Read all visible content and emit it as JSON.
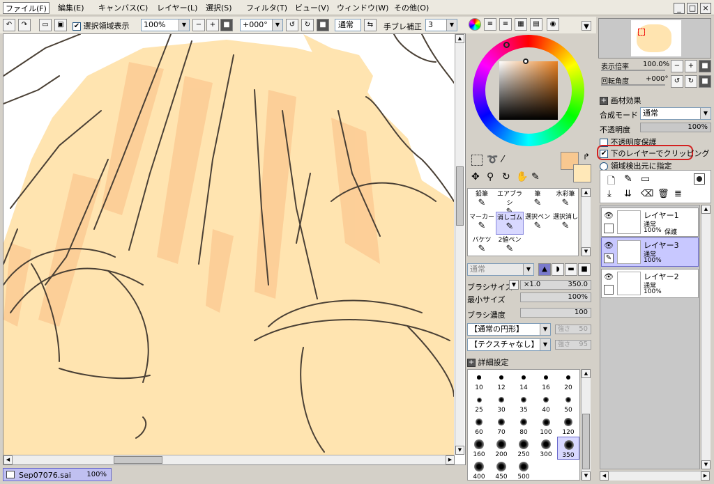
{
  "menu": {
    "items": [
      "ファイル(F)",
      "編集(E)",
      "キャンバス(C)",
      "レイヤー(L)",
      "選択(S)",
      "フィルタ(T)",
      "ビュー(V)",
      "ウィンドウ(W)",
      "その他(O)"
    ]
  },
  "toolbar": {
    "selection_display_label": "選択領域表示",
    "zoom_value": "100%",
    "rotation_value": "+000°",
    "mode_label": "通常",
    "stabilizer_label": "手ブレ補正",
    "stabilizer_value": "3"
  },
  "navigator": {
    "zoom_label": "表示倍率",
    "zoom_value": "100.0%",
    "rotation_label": "回転角度",
    "rotation_value": "+000°"
  },
  "paper_texture": {
    "section_label": "画材効果"
  },
  "layer_props": {
    "blend_label": "合成モード",
    "blend_value": "通常",
    "opacity_label": "不透明度",
    "opacity_value": "100%",
    "protect_opacity_label": "不透明度保護",
    "clip_label": "下のレイヤーでクリッピング",
    "selection_source_label": "領域検出元に指定"
  },
  "layers": [
    {
      "name": "レイヤー1",
      "mode": "通常",
      "opacity": "100%",
      "extra": "保護"
    },
    {
      "name": "レイヤー3",
      "mode": "通常",
      "opacity": "100%",
      "extra": ""
    },
    {
      "name": "レイヤー2",
      "mode": "通常",
      "opacity": "100%",
      "extra": ""
    }
  ],
  "tools": [
    {
      "label": "鉛筆"
    },
    {
      "label": "エアブラシ"
    },
    {
      "label": "筆"
    },
    {
      "label": "水彩筆"
    },
    {
      "label": "マーカー"
    },
    {
      "label": "消しゴム"
    },
    {
      "label": "選択ペン"
    },
    {
      "label": "選択消し"
    },
    {
      "label": "バケツ"
    },
    {
      "label": "2値ペン"
    }
  ],
  "brush_settings": {
    "mode_value": "通常",
    "size_label": "ブラシサイズ",
    "size_multiplier": "×1.0",
    "size_value": "350.0",
    "min_size_label": "最小サイズ",
    "min_size_value": "100%",
    "density_label": "ブラシ濃度",
    "density_value": "100",
    "shape_value": "【通常の円形】",
    "shape_strength_label": "強さ",
    "shape_strength_value": "50",
    "texture_value": "【テクスチャなし】",
    "texture_strength_label": "強さ",
    "texture_strength_value": "95",
    "advanced_label": "詳細設定"
  },
  "brush_sizes": [
    "10",
    "12",
    "14",
    "16",
    "20",
    "25",
    "30",
    "35",
    "40",
    "50",
    "60",
    "70",
    "80",
    "100",
    "120",
    "160",
    "200",
    "250",
    "300",
    "350",
    "400",
    "450",
    "500"
  ],
  "document": {
    "filename": "Sep07076.sai",
    "zoom": "100%"
  },
  "colors": {
    "primary": "#f8c890",
    "secondary": "#ffe8b8",
    "fill_color": "#ffe4b0",
    "selection_blue": "#6a6acc"
  }
}
